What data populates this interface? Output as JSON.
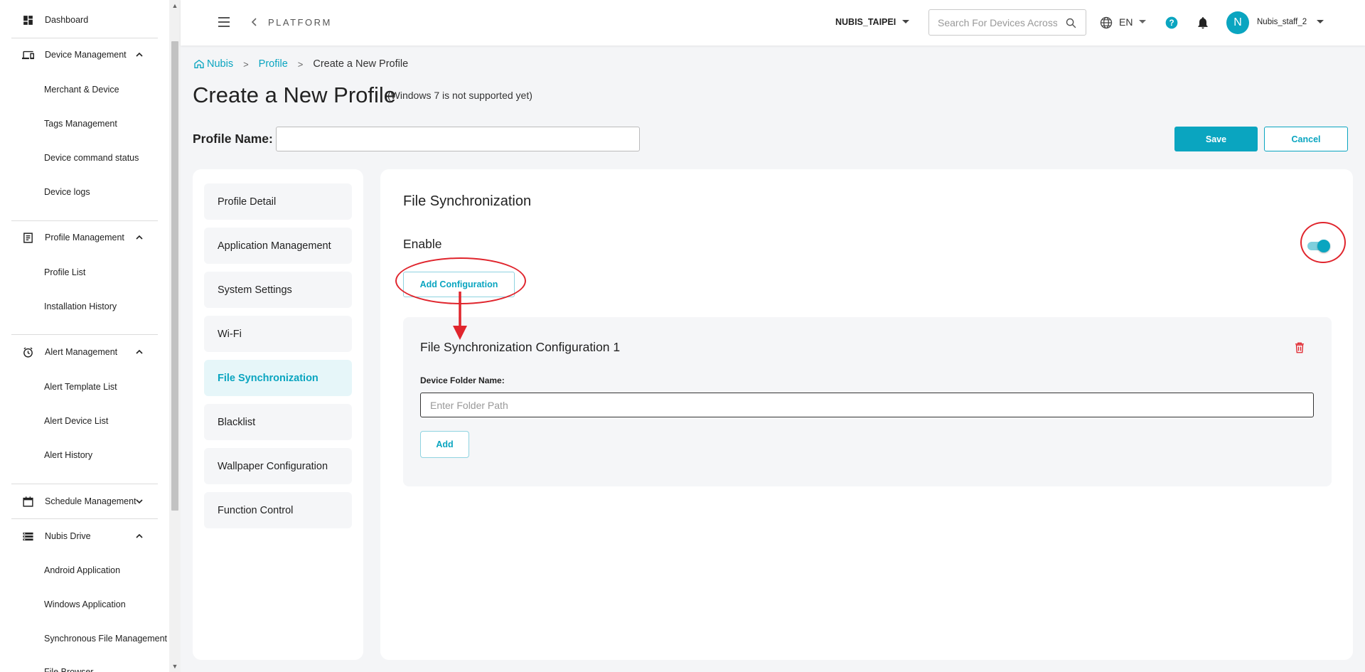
{
  "sidebar": {
    "dashboard": "Dashboard",
    "device_management": {
      "label": "Device Management",
      "items": [
        "Merchant & Device",
        "Tags Management",
        "Device command status",
        "Device logs"
      ]
    },
    "profile_management": {
      "label": "Profile Management",
      "items": [
        "Profile List",
        "Installation History"
      ]
    },
    "alert_management": {
      "label": "Alert Management",
      "items": [
        "Alert Template List",
        "Alert Device List",
        "Alert History"
      ]
    },
    "schedule_management": {
      "label": "Schedule Management"
    },
    "nubis_drive": {
      "label": "Nubis Drive",
      "items": [
        "Android Application",
        "Windows Application",
        "Synchronous File Management",
        "File Browser"
      ]
    }
  },
  "header": {
    "platform": "PLATFORM",
    "organization": "NUBIS_TAIPEI",
    "search_placeholder": "Search For Devices Across Organizations",
    "language": "EN",
    "avatar_initial": "N",
    "username": "Nubis_staff_2"
  },
  "breadcrumb": {
    "home": "Nubis",
    "parent": "Profile",
    "current": "Create a New Profile"
  },
  "page": {
    "title": "Create a New Profile",
    "note": "(Windows 7 is not supported yet)",
    "profile_name_label": "Profile Name:",
    "profile_name_value": "",
    "save_label": "Save",
    "cancel_label": "Cancel"
  },
  "profile_nav": {
    "items": [
      "Profile Detail",
      "Application Management",
      "System Settings",
      "Wi-Fi",
      "File Synchronization",
      "Blacklist",
      "Wallpaper Configuration",
      "Function Control"
    ],
    "active": "File Synchronization"
  },
  "file_sync": {
    "title": "File Synchronization",
    "enable_label": "Enable",
    "enabled": true,
    "add_configuration_label": "Add Configuration",
    "configuration": {
      "title": "File Synchronization Configuration 1",
      "folder_label": "Device Folder Name:",
      "folder_placeholder": "Enter Folder Path",
      "add_label": "Add"
    }
  },
  "colors": {
    "accent": "#0aa5c0",
    "annotation": "#e0252d",
    "delete": "#e0252d"
  }
}
